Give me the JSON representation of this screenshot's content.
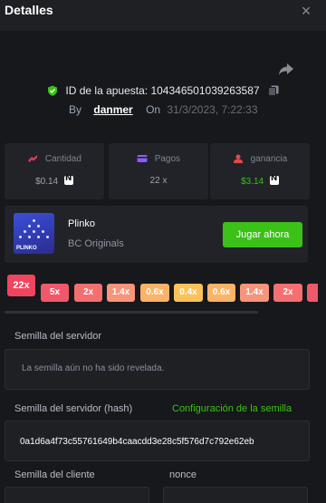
{
  "header": {
    "title": "Detalles",
    "close_label": "×"
  },
  "bet": {
    "id_label": "ID de la apuesta: 104346501039263587",
    "by_label": "By",
    "user": "danmer",
    "on_label": "On",
    "date": "31/3/2023, 7:22:33"
  },
  "stats": [
    {
      "label": "Cantidad",
      "value": "$0.14",
      "icon": "money-icon",
      "color": "#e03a5a"
    },
    {
      "label": "Pagos",
      "value": "22 x",
      "icon": "card-icon",
      "color": "#8b5cf6"
    },
    {
      "label": "ganancia",
      "value": "$3.14",
      "icon": "profit-icon",
      "color": "#e54848"
    }
  ],
  "game": {
    "name": "Plinko",
    "provider": "BC Originals",
    "play_label": "Jugar ahora",
    "thumb_tag": "PLINKO"
  },
  "multipliers": [
    {
      "label": "22x",
      "color": "#f0455f"
    },
    {
      "label": "5x",
      "color": "#f0596a"
    },
    {
      "label": "2x",
      "color": "#f46f6f"
    },
    {
      "label": "1.4x",
      "color": "#f7947a"
    },
    {
      "label": "0.6x",
      "color": "#fbb367"
    },
    {
      "label": "0.4x",
      "color": "#fcc25a"
    },
    {
      "label": "0.6x",
      "color": "#fbb367"
    },
    {
      "label": "1.4x",
      "color": "#f7947a"
    },
    {
      "label": "2x",
      "color": "#f46f6f"
    }
  ],
  "server_seed": {
    "label": "Semilla del servidor",
    "value": "La semilla aún no ha sido revelada."
  },
  "server_hash": {
    "label": "Semilla del servidor (hash)",
    "link": "Configuración de la semilla",
    "value": "0a1d6a4f73c55761649b4caacdd3e28c5f576d7c792e62eb"
  },
  "client_seed": {
    "label": "Semilla del cliente"
  },
  "nonce": {
    "label": "nonce"
  },
  "colors": {
    "accent": "#3bc117",
    "background": "#17181b",
    "panel": "#222328"
  }
}
